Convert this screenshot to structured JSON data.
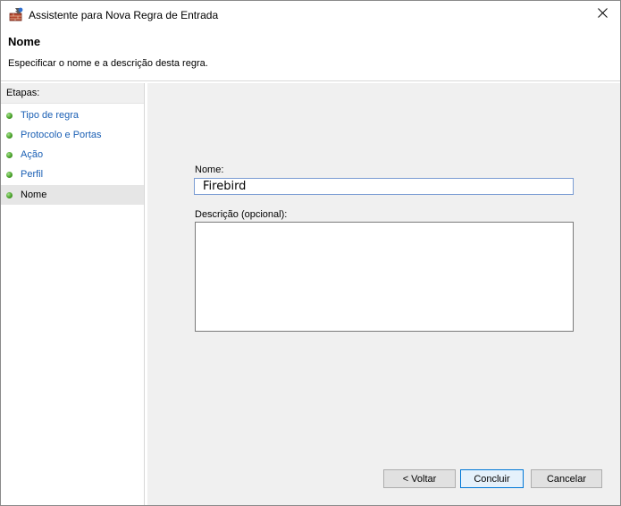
{
  "window": {
    "title": "Assistente para Nova Regra de Entrada",
    "icon": "firewall-rule-icon",
    "close_icon": "close-icon"
  },
  "header": {
    "title": "Nome",
    "subtitle": "Especificar o nome e a descrição desta regra."
  },
  "steps": {
    "title": "Etapas:",
    "items": [
      {
        "label": "Tipo de regra"
      },
      {
        "label": "Protocolo e Portas"
      },
      {
        "label": "Ação"
      },
      {
        "label": "Perfil"
      },
      {
        "label": "Nome",
        "current": true
      }
    ]
  },
  "form": {
    "name_label": "Nome:",
    "name_value": "Firebird",
    "description_label": "Descrição (opcional):",
    "description_value": ""
  },
  "buttons": {
    "back": "< Voltar",
    "finish": "Concluir",
    "cancel": "Cancelar"
  },
  "colors": {
    "link": "#1a5fb4",
    "step_dot": "#4aa22b",
    "focus_border": "#0078d7",
    "panel_bg": "#f0f0f0"
  }
}
